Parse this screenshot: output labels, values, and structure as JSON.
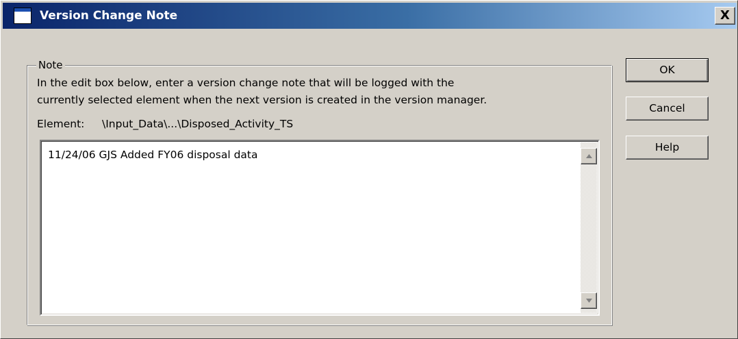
{
  "window": {
    "title": "Version Change Note",
    "close_label": "X"
  },
  "note_group": {
    "legend": "Note",
    "instruction_line1": "In the edit box below, enter a version change note that will be logged with the",
    "instruction_line2": "currently selected element when the next version is created in the version manager.",
    "element_label": "Element:",
    "element_value": "\\Input_Data\\...\\Disposed_Activity_TS",
    "note_text": "11/24/06 GJS Added FY06 disposal data"
  },
  "buttons": {
    "ok": "OK",
    "cancel": "Cancel",
    "help": "Help"
  },
  "icons": {
    "window": "window-icon",
    "close": "close-icon",
    "scroll_up": "scroll-up-arrow-icon",
    "scroll_down": "scroll-down-arrow-icon"
  },
  "colors": {
    "titlebar_start": "#0a246a",
    "titlebar_end": "#a6caf0",
    "dialog_face": "#d4d0c8"
  }
}
